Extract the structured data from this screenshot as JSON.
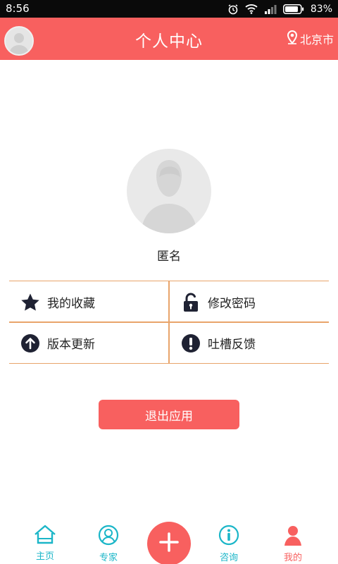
{
  "status_bar": {
    "time": "8:56",
    "battery_percent": "83%",
    "icons": [
      "alarm-icon",
      "wifi-icon",
      "signal-icon",
      "battery-icon"
    ]
  },
  "header": {
    "title": "个人中心",
    "location": "北京市",
    "background_color": "#f8605f"
  },
  "profile": {
    "name": "匿名"
  },
  "menu": [
    {
      "label": "我的收藏",
      "icon": "star-icon"
    },
    {
      "label": "修改密码",
      "icon": "unlock-icon"
    },
    {
      "label": "版本更新",
      "icon": "arrow-up-circle-icon"
    },
    {
      "label": "吐槽反馈",
      "icon": "exclamation-circle-icon"
    }
  ],
  "logout_label": "退出应用",
  "bottom_nav": [
    {
      "label": "主页",
      "icon": "home-icon",
      "color": "#1bb6c8"
    },
    {
      "label": "专家",
      "icon": "expert-icon",
      "color": "#1bb6c8"
    },
    {
      "label": "",
      "icon": "plus-icon",
      "color": "#f8605f"
    },
    {
      "label": "咨询",
      "icon": "info-icon",
      "color": "#1bb6c8"
    },
    {
      "label": "我的",
      "icon": "person-icon",
      "color": "#f8605f"
    }
  ],
  "colors": {
    "accent": "#f8605f",
    "teal": "#1bb6c8",
    "divider": "#e8a46a"
  }
}
